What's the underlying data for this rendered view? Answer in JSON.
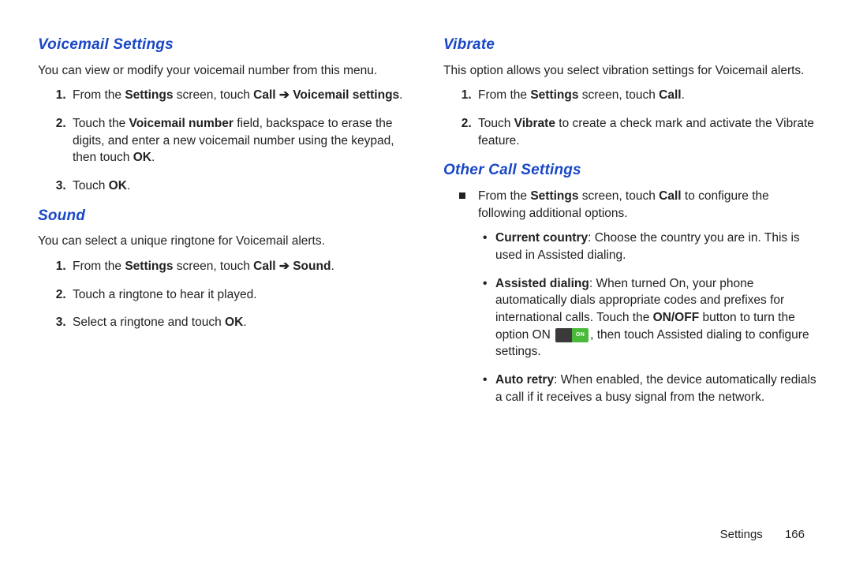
{
  "left": {
    "sec1": {
      "heading": "Voicemail Settings",
      "intro": "You can view or modify your voicemail number from this menu.",
      "step1_a": "From the ",
      "step1_b": "Settings",
      "step1_c": " screen, touch ",
      "step1_d": "Call",
      "step1_e": " ",
      "step1_arrow": "➔",
      "step1_f": " ",
      "step1_g": "Voicemail settings",
      "step1_h": ".",
      "step2_a": "Touch the ",
      "step2_b": "Voicemail number",
      "step2_c": " field, backspace to erase the digits, and enter a new voicemail number using the keypad, then touch ",
      "step2_d": "OK",
      "step2_e": ".",
      "step3_a": "Touch ",
      "step3_b": "OK",
      "step3_c": "."
    },
    "sec2": {
      "heading": "Sound",
      "intro": "You can select a unique ringtone for Voicemail alerts.",
      "step1_a": "From the ",
      "step1_b": "Settings",
      "step1_c": " screen, touch ",
      "step1_d": "Call",
      "step1_e": " ",
      "step1_arrow": "➔",
      "step1_f": " ",
      "step1_g": "Sound",
      "step1_h": ".",
      "step2": "Touch a ringtone to hear it played.",
      "step3_a": " Select a ringtone and touch ",
      "step3_b": "OK",
      "step3_c": "."
    }
  },
  "right": {
    "sec1": {
      "heading": "Vibrate",
      "intro": "This option allows you select vibration settings for Voicemail alerts.",
      "step1_a": "From the ",
      "step1_b": "Settings",
      "step1_c": " screen, touch ",
      "step1_d": "Call",
      "step1_e": ".",
      "step2_a": "Touch ",
      "step2_b": "Vibrate",
      "step2_c": " to create a check mark and activate the Vibrate feature."
    },
    "sec2": {
      "heading": "Other Call Settings",
      "lead_a": "From the ",
      "lead_b": "Settings",
      "lead_c": " screen, touch ",
      "lead_d": "Call",
      "lead_e": " to configure the following additional options.",
      "b1_a": "Current country",
      "b1_b": ": Choose the country you are in. This is used in Assisted dialing.",
      "b2_a": "Assisted dialing",
      "b2_b": ": When turned On, your phone automatically dials appropriate codes and prefixes for international calls. Touch the ",
      "b2_c": "ON/OFF",
      "b2_d": " button to turn the option ON ",
      "toggle_on_label": "ON",
      "b2_e": ", then touch Assisted dialing to configure settings.",
      "b3_a": "Auto retry",
      "b3_b": ": When enabled, the device automatically redials a call if it receives a busy signal from the network."
    }
  },
  "footer": {
    "section": "Settings",
    "page": "166"
  }
}
